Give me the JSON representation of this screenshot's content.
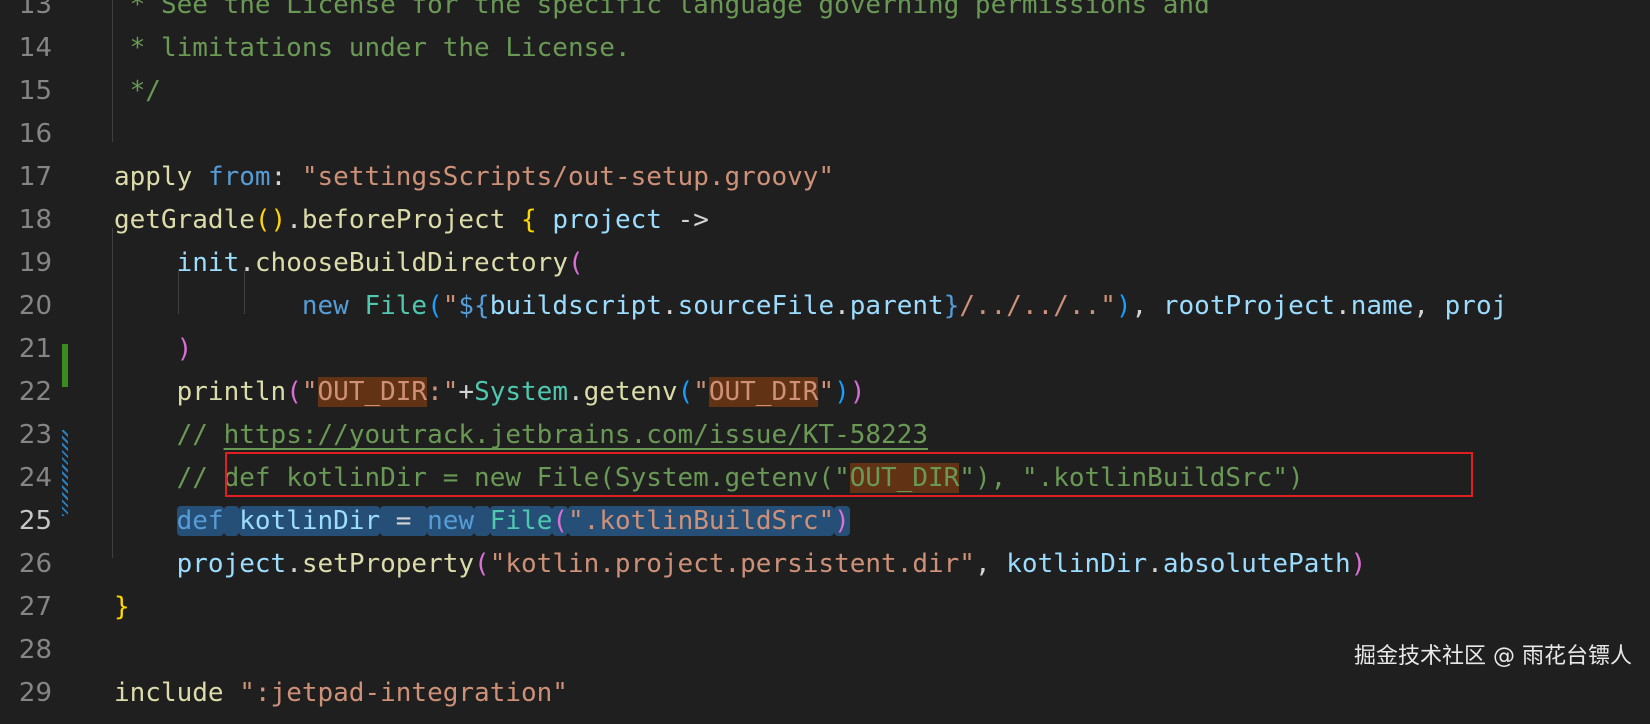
{
  "editor": {
    "language": "groovy",
    "current_line": "25",
    "colors": {
      "background": "#1f1f1f",
      "comment": "#6a9955",
      "string": "#ce9178",
      "keyword": "#569cd6",
      "function": "#dcdcaa",
      "variable": "#9cdcfe",
      "class": "#4ec9b0",
      "find_highlight": "#613214",
      "selection": "#264f78",
      "annotation_box": "#e02020"
    },
    "lines": [
      {
        "number": "13",
        "text": " * See the License for the specific language governing permissions and"
      },
      {
        "number": "14",
        "text": " * limitations under the License."
      },
      {
        "number": "15",
        "text": " */"
      },
      {
        "number": "16",
        "text": ""
      },
      {
        "number": "17",
        "text": "apply from: \"settingsScripts/out-setup.groovy\""
      },
      {
        "number": "18",
        "text": "getGradle().beforeProject { project ->"
      },
      {
        "number": "19",
        "text": "    init.chooseBuildDirectory("
      },
      {
        "number": "20",
        "text": "            new File(\"${buildscript.sourceFile.parent}/../../..\"), rootProject.name, proj"
      },
      {
        "number": "21",
        "text": "    )"
      },
      {
        "number": "22",
        "text": "    println(\"OUT_DIR:\"+System.getenv(\"OUT_DIR\"))"
      },
      {
        "number": "23",
        "text": "    // https://youtrack.jetbrains.com/issue/KT-58223"
      },
      {
        "number": "24",
        "text": "    // def kotlinDir = new File(System.getenv(\"OUT_DIR\"), \".kotlinBuildSrc\")"
      },
      {
        "number": "25",
        "text": "    def kotlinDir = new File(\".kotlinBuildSrc\")"
      },
      {
        "number": "26",
        "text": "    project.setProperty(\"kotlin.project.persistent.dir\", kotlinDir.absolutePath)"
      },
      {
        "number": "27",
        "text": "}"
      },
      {
        "number": "28",
        "text": ""
      },
      {
        "number": "29",
        "text": "include \":jetpad-integration\""
      }
    ]
  },
  "watermark": "掘金技术社区 @ 雨花台镖人"
}
